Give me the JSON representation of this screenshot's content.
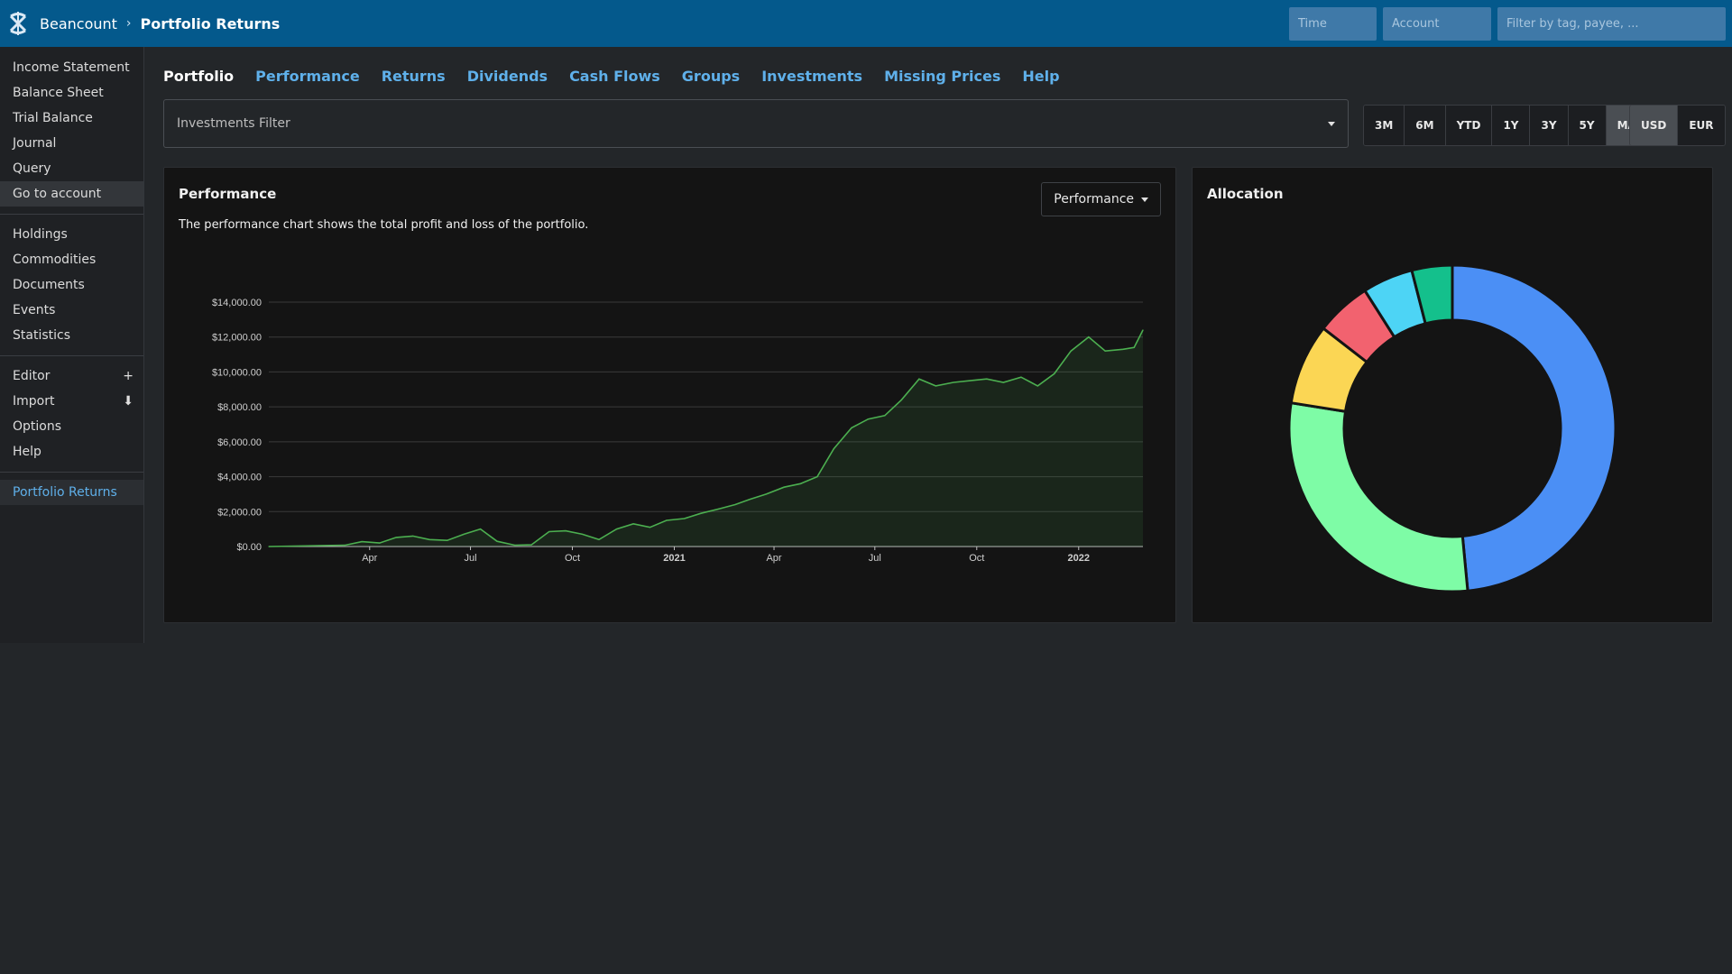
{
  "header": {
    "app_name": "Beancount",
    "separator": "›",
    "page_title": "Portfolio Returns",
    "time_placeholder": "Time",
    "account_placeholder": "Account",
    "filter_placeholder": "Filter by tag, payee, ..."
  },
  "sidebar": {
    "group1": [
      "Income Statement",
      "Balance Sheet",
      "Trial Balance",
      "Journal",
      "Query",
      "Go to account"
    ],
    "group2": [
      "Holdings",
      "Commodities",
      "Documents",
      "Events",
      "Statistics"
    ],
    "group3": [
      {
        "label": "Editor",
        "aux": "+"
      },
      {
        "label": "Import",
        "aux": "⬇"
      },
      {
        "label": "Options",
        "aux": ""
      },
      {
        "label": "Help",
        "aux": ""
      }
    ],
    "group4": [
      "Portfolio Returns"
    ]
  },
  "tabs": [
    "Portfolio",
    "Performance",
    "Returns",
    "Dividends",
    "Cash Flows",
    "Groups",
    "Investments",
    "Missing Prices",
    "Help"
  ],
  "investments_filter": "Investments Filter",
  "periods": [
    "3M",
    "6M",
    "YTD",
    "1Y",
    "3Y",
    "5Y",
    "MAX"
  ],
  "selected_period": "MAX",
  "currencies": [
    "USD",
    "EUR"
  ],
  "selected_currency": "USD",
  "performance": {
    "title": "Performance",
    "description": "The performance chart shows the total profit and loss of the portfolio.",
    "mode": "Performance"
  },
  "allocation": {
    "title": "Allocation"
  },
  "colors": {
    "header": "#04598c",
    "link": "#5fb0ea",
    "line": "#4caf50"
  },
  "chart_data": [
    {
      "type": "area",
      "x_ticks": [
        {
          "label": "Apr",
          "date": "2020-04-01",
          "bold": false
        },
        {
          "label": "Jul",
          "date": "2020-07-01",
          "bold": false
        },
        {
          "label": "Oct",
          "date": "2020-10-01",
          "bold": false
        },
        {
          "label": "2021",
          "date": "2021-01-01",
          "bold": true
        },
        {
          "label": "Apr",
          "date": "2021-04-01",
          "bold": false
        },
        {
          "label": "Jul",
          "date": "2021-07-01",
          "bold": false
        },
        {
          "label": "Oct",
          "date": "2021-10-01",
          "bold": false
        },
        {
          "label": "2022",
          "date": "2022-01-01",
          "bold": true
        }
      ],
      "y_ticks": [
        "$0.00",
        "$2,000.00",
        "$4,000.00",
        "$6,000.00",
        "$8,000.00",
        "$10,000.00",
        "$12,000.00",
        "$14,000.00"
      ],
      "ylim": [
        0,
        14000
      ],
      "xlim": [
        "2020-01-01",
        "2022-02-28"
      ],
      "grid": true,
      "x": [
        "2020-01-01",
        "2020-02-15",
        "2020-03-10",
        "2020-03-25",
        "2020-04-10",
        "2020-04-25",
        "2020-05-10",
        "2020-05-25",
        "2020-06-10",
        "2020-06-25",
        "2020-07-10",
        "2020-07-25",
        "2020-08-10",
        "2020-08-25",
        "2020-09-10",
        "2020-09-25",
        "2020-10-10",
        "2020-10-25",
        "2020-11-10",
        "2020-11-25",
        "2020-12-10",
        "2020-12-25",
        "2021-01-10",
        "2021-01-25",
        "2021-02-10",
        "2021-02-25",
        "2021-03-10",
        "2021-03-25",
        "2021-04-10",
        "2021-04-25",
        "2021-05-10",
        "2021-05-25",
        "2021-06-10",
        "2021-06-25",
        "2021-07-10",
        "2021-07-25",
        "2021-08-10",
        "2021-08-25",
        "2021-09-10",
        "2021-09-25",
        "2021-10-10",
        "2021-10-25",
        "2021-11-10",
        "2021-11-25",
        "2021-12-10",
        "2021-12-25",
        "2022-01-10",
        "2022-01-25",
        "2022-02-10",
        "2022-02-20",
        "2022-02-28"
      ],
      "values": [
        0,
        50,
        80,
        280,
        200,
        520,
        600,
        400,
        350,
        700,
        1000,
        300,
        80,
        100,
        850,
        900,
        700,
        400,
        1000,
        1300,
        1100,
        1500,
        1600,
        1900,
        2150,
        2400,
        2700,
        3000,
        3400,
        3600,
        4000,
        5600,
        6800,
        7300,
        7500,
        8400,
        9600,
        9200,
        9400,
        9500,
        9600,
        9400,
        9700,
        9200,
        9900,
        11200,
        12000,
        11200,
        11300,
        11400,
        12400
      ],
      "series": [
        {
          "name": "",
          "color": "#4caf50"
        }
      ]
    },
    {
      "type": "pie",
      "subtype": "donut",
      "slices": [
        {
          "value": 48.5,
          "color": "#4b8ff5"
        },
        {
          "value": 29.0,
          "color": "#7efca6"
        },
        {
          "value": 8.0,
          "color": "#fbd654"
        },
        {
          "value": 5.5,
          "color": "#f2626f"
        },
        {
          "value": 5.0,
          "color": "#4dd4f5"
        },
        {
          "value": 4.0,
          "color": "#14c08c"
        }
      ]
    }
  ]
}
